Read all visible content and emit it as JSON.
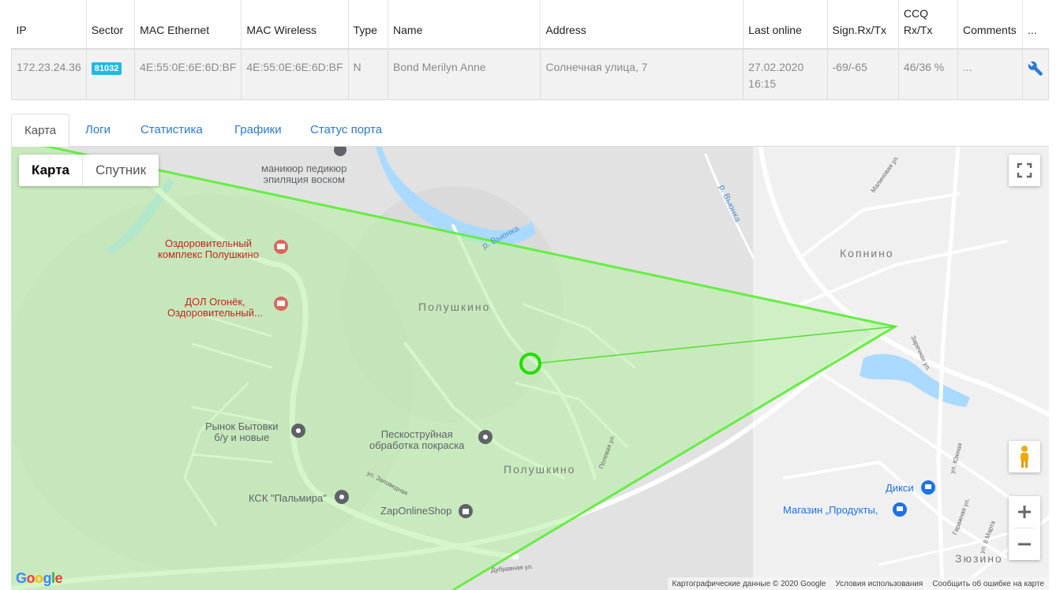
{
  "table": {
    "headers": [
      "IP",
      "Sector",
      "MAC Ethernet",
      "MAC Wireless",
      "Type",
      "Name",
      "Address",
      "Last online",
      "Sign.Rx/Tx",
      "CCQ Rx/Tx",
      "Comments",
      "..."
    ],
    "row": {
      "ip": "172.23.24.36",
      "sector": "81032",
      "mac_ethernet": "4E:55:0E:6E:6D:BF",
      "mac_wireless": "4E:55:0E:6E:6D:BF",
      "type": "N",
      "name": "Bond Merilyn Anne",
      "address": "Солнечная улица, 7",
      "last_online": "27.02.2020 16:15",
      "signal": "-69/-65",
      "ccq": "46/36 %",
      "comments": "...",
      "action_icon": "wrench-icon"
    },
    "colors": {
      "badge": "#23b7e5",
      "link": "#2a7ad6"
    }
  },
  "tabs": [
    {
      "label": "Карта",
      "active": true
    },
    {
      "label": "Логи",
      "active": false
    },
    {
      "label": "Статистика",
      "active": false
    },
    {
      "label": "Графики",
      "active": false
    },
    {
      "label": "Статус порта",
      "active": false
    }
  ],
  "map": {
    "type_buttons": {
      "map": "Карта",
      "satellite": "Спутник"
    },
    "places": {
      "manicure": "маникюр педикюр\nэпиляция воском",
      "health_complex": "Оздоровительный\nкомплекс Полушкино",
      "camp": "ДОЛ Огонёк,\nОздоровительный...",
      "poluskino_north": "Полушкино",
      "poluskino_south": "Полушкино",
      "kopnino": "Копнино",
      "zyuzino": "Зюзино",
      "market": "Рынок Бытовки\nб/у и новые",
      "sandblast": "Пескоструйная\nобработка покраска",
      "ksk": "КСК \"Пальмира\"",
      "zaponline": "ZapOnlineShop",
      "diksi": "Дикси",
      "produkty": "Магазин „Продукты,"
    },
    "rivers": {
      "vyunka_1": "р. Вьюнка",
      "vyunka_2": "р. Вьюнка"
    },
    "streets": {
      "malinovaya": "Малиновая ул.",
      "zarechnaya": "Заречная ул.",
      "zapovednaya": "ул. Заповедная",
      "polevaya": "Полевая ул.",
      "yuzhnaya": "ул. Южная",
      "garazhnaya": "Гаражная ул.",
      "marta": "ул. 8 Марта",
      "dubravnaya": "Дубравная ул."
    },
    "attribution": {
      "data": "Картографические данные © 2020 Google",
      "terms": "Условия использования",
      "report": "Сообщить об ошибке на карте"
    },
    "google_logo": "Google",
    "colors": {
      "sector_fill": "#b9f0a6",
      "sector_line": "#66ee44",
      "client_ring": "#22dd00",
      "water": "#aadaff"
    },
    "icons": [
      "fullscreen-icon",
      "pegman-icon",
      "zoom-in-icon",
      "zoom-out-icon",
      "hotel-icon",
      "pin-icon",
      "cart-icon",
      "bag-icon"
    ]
  }
}
